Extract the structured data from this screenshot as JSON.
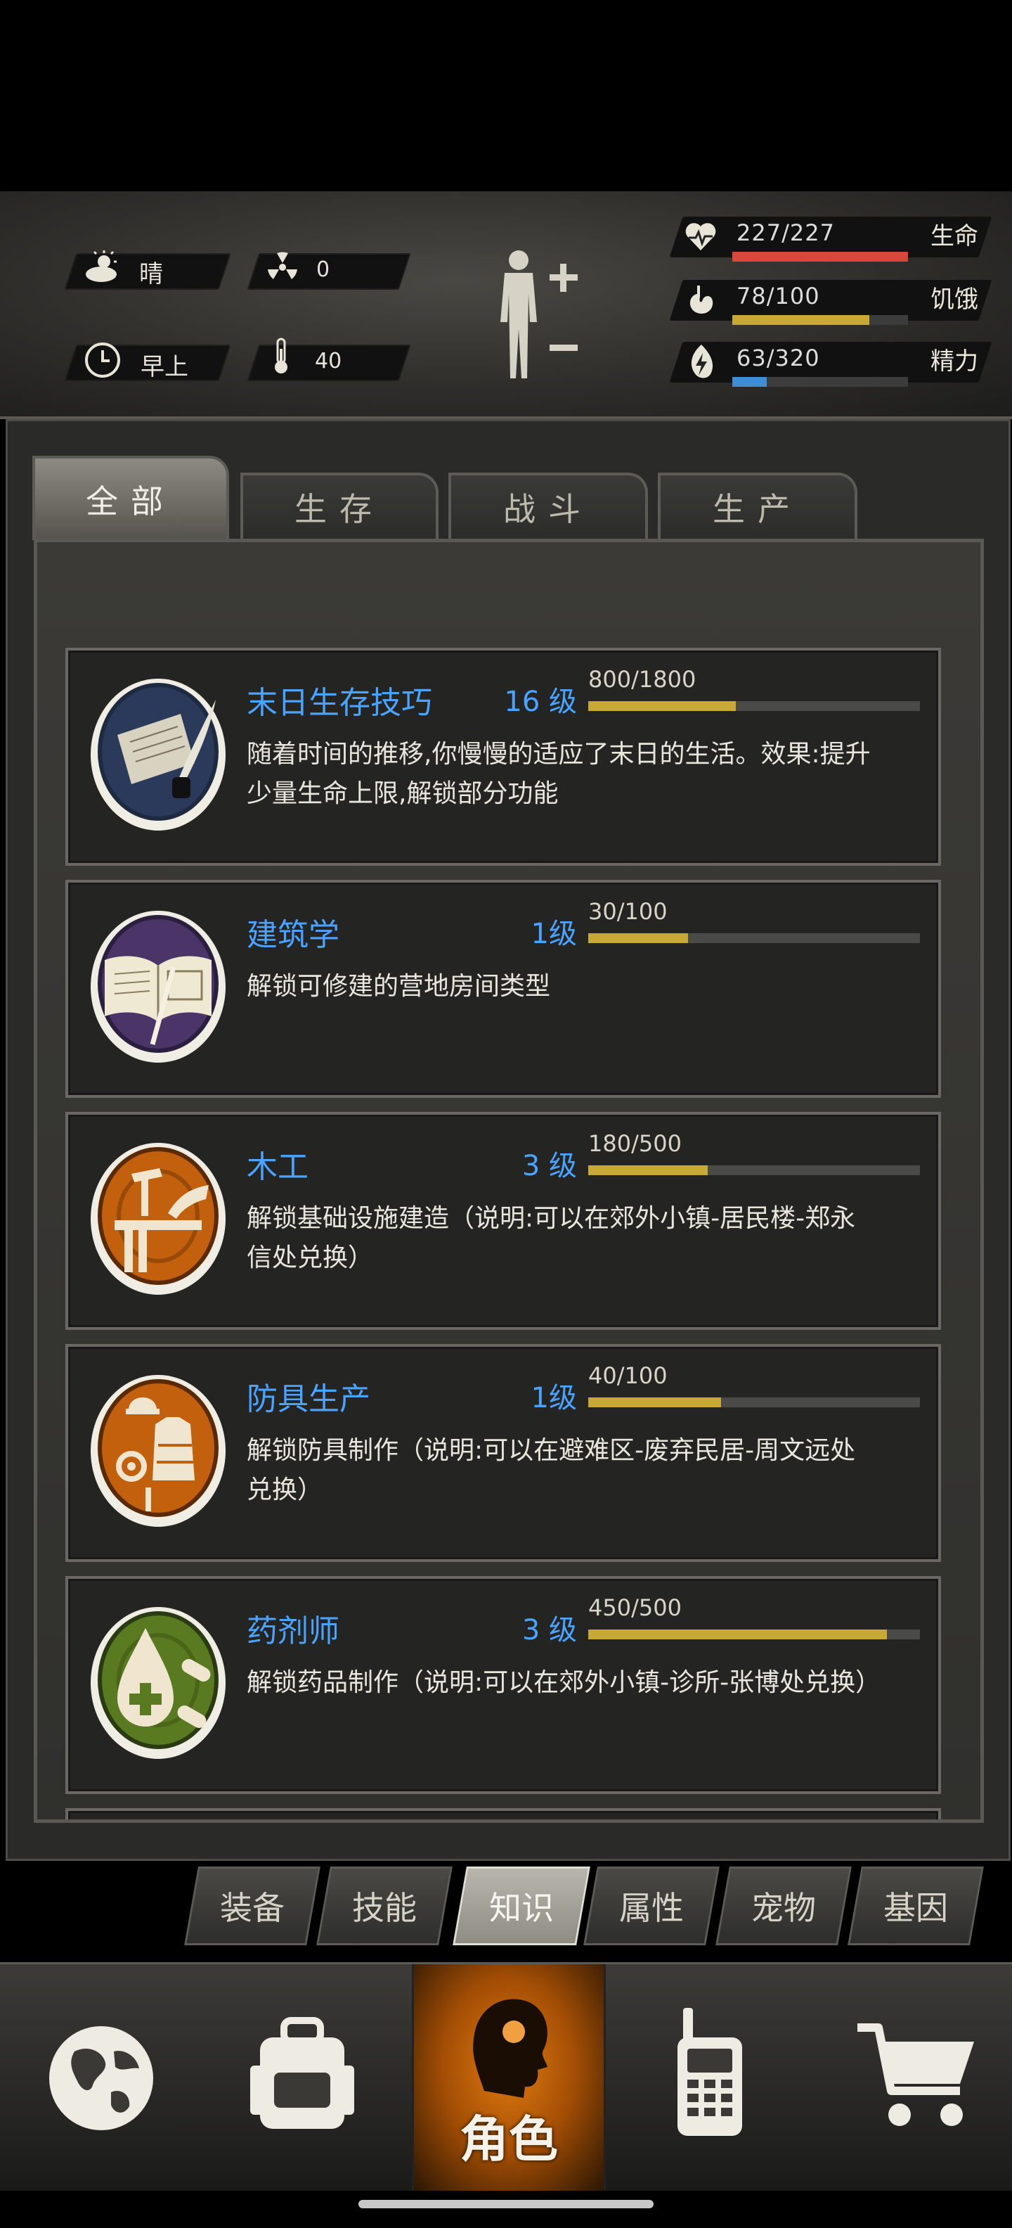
{
  "status": {
    "weather": "晴",
    "radiation": "0",
    "time_of_day": "早上",
    "temperature": "40",
    "vitals": [
      {
        "label": "生命",
        "value": "227/227",
        "fraction": 1.0,
        "color": "#d9473a"
      },
      {
        "label": "饥饿",
        "value": "78/100",
        "fraction": 0.78,
        "color": "#c9a935"
      },
      {
        "label": "精力",
        "value": "63/320",
        "fraction": 0.197,
        "color": "#3e8ed6"
      }
    ]
  },
  "tabs": [
    {
      "label": "全部",
      "active": true
    },
    {
      "label": "生存",
      "active": false
    },
    {
      "label": "战斗",
      "active": false
    },
    {
      "label": "生产",
      "active": false
    }
  ],
  "knowledge": [
    {
      "title": "末日生存技巧",
      "level": "16 级",
      "progress_text": "800/1800",
      "progress": 0.444,
      "description": "随着时间的推移,你慢慢的适应了末日的生活。效果:提升少量生命上限,解锁部分功能",
      "icon": "scroll-quill-icon"
    },
    {
      "title": "建筑学",
      "level": "1级",
      "progress_text": "30/100",
      "progress": 0.3,
      "description": "解锁可修建的营地房间类型",
      "icon": "blueprint-book-icon"
    },
    {
      "title": "木工",
      "level": "3 级",
      "progress_text": "180/500",
      "progress": 0.36,
      "description": "解锁基础设施建造（说明:可以在郊外小镇-居民楼-郑永信处兑换）",
      "icon": "woodwork-icon"
    },
    {
      "title": "防具生产",
      "level": "1级",
      "progress_text": "40/100",
      "progress": 0.4,
      "description": "解锁防具制作（说明:可以在避难区-废弃民居-周文远处兑换）",
      "icon": "armor-craft-icon"
    },
    {
      "title": "药剂师",
      "level": "3 级",
      "progress_text": "450/500",
      "progress": 0.9,
      "description": "解锁药品制作（说明:可以在郊外小镇-诊所-张博处兑换）",
      "icon": "medicine-icon"
    }
  ],
  "subtabs": [
    {
      "label": "装备",
      "active": false
    },
    {
      "label": "技能",
      "active": false
    },
    {
      "label": "知识",
      "active": true
    },
    {
      "label": "属性",
      "active": false
    },
    {
      "label": "宠物",
      "active": false
    },
    {
      "label": "基因",
      "active": false
    }
  ],
  "bottom_nav": {
    "world": "globe-icon",
    "backpack": "backpack-icon",
    "character_label": "角色",
    "radio": "walkie-talkie-icon",
    "shop": "shopping-cart-icon"
  },
  "colors": {
    "title_blue": "#4aa3ff",
    "progress_gold": "#c9a935",
    "active_orange": "#e07a10"
  }
}
